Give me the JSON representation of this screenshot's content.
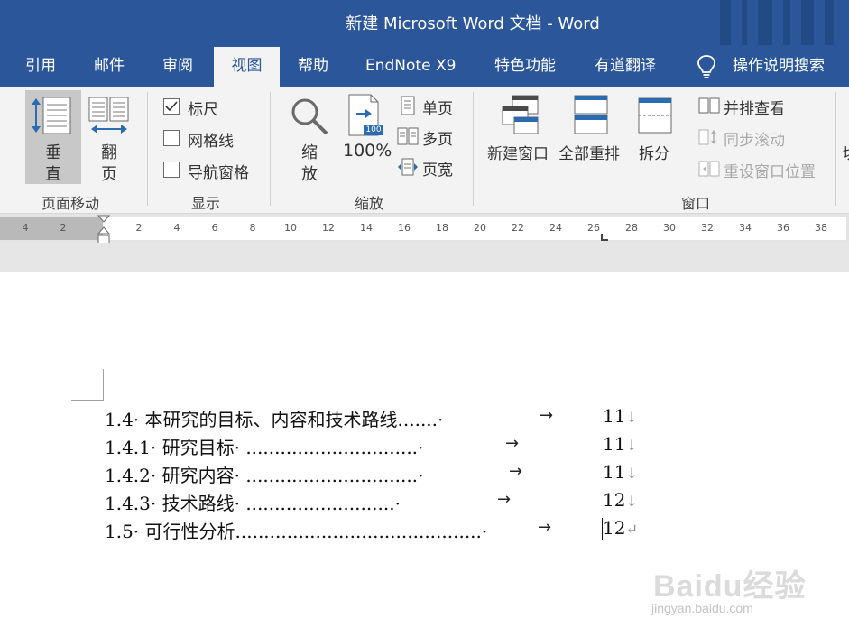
{
  "window": {
    "title": "新建 Microsoft Word 文档  -  Word"
  },
  "tabs": [
    {
      "label": "引用"
    },
    {
      "label": "邮件"
    },
    {
      "label": "审阅"
    },
    {
      "label": "视图",
      "active": true
    },
    {
      "label": "帮助"
    },
    {
      "label": "EndNote X9"
    },
    {
      "label": "特色功能"
    },
    {
      "label": "有道翻译"
    },
    {
      "label": "操作说明搜索"
    }
  ],
  "ribbon": {
    "page_move": {
      "group_label": "页面移动",
      "vertical_1": "垂",
      "vertical_2": "直",
      "flip_1": "翻",
      "flip_2": "页"
    },
    "show": {
      "group_label": "显示",
      "ruler": {
        "label": "标尺",
        "checked": true
      },
      "gridlines": {
        "label": "网格线",
        "checked": false
      },
      "nav_pane": {
        "label": "导航窗格",
        "checked": false
      }
    },
    "zoom": {
      "group_label": "缩放",
      "zoom_1": "缩",
      "zoom_2": "放",
      "hundred_label": "100%",
      "hundred_badge": "100",
      "one_page": "单页",
      "multi_page": "多页",
      "page_width": "页宽"
    },
    "window": {
      "group_label": "窗口",
      "new_window": "新建窗口",
      "arrange_all": "全部重排",
      "split": "拆分",
      "side_by_side": "并排查看",
      "sync_scroll": "同步滚动",
      "reset_position": "重设窗口位置"
    },
    "cutoff_glyph": "切"
  },
  "ruler": {
    "ticks": [
      "4",
      "2",
      "2",
      "4",
      "6",
      "8",
      "10",
      "12",
      "14",
      "16",
      "18",
      "20",
      "22",
      "24",
      "26",
      "28",
      "30",
      "32",
      "34",
      "36",
      "38"
    ]
  },
  "document": {
    "toc": [
      {
        "text": "1.4· 本研究的目标、内容和技术路线.......·",
        "arrow": "→",
        "page": "11",
        "mark": "↓"
      },
      {
        "text": "1.4.1· 研究目标· ..............................·",
        "arrow": "→",
        "page": "11",
        "mark": "↓"
      },
      {
        "text": "1.4.2· 研究内容· ..............................·",
        "arrow": "→",
        "page": "11",
        "mark": "↓"
      },
      {
        "text": "1.4.3· 技术路线· ..........................·",
        "arrow": "→",
        "page": "12",
        "mark": "↓"
      },
      {
        "text": "1.5· 可行性分析...........................................·",
        "arrow": "→",
        "page": "12",
        "mark": "↵"
      }
    ]
  },
  "watermark": {
    "brand": "Baidu经验",
    "url": "jingyan.baidu.com"
  },
  "colors": {
    "title_bar": "#2b579a",
    "ribbon_bg": "#f3f3f3",
    "accent_blue": "#2b579a"
  }
}
